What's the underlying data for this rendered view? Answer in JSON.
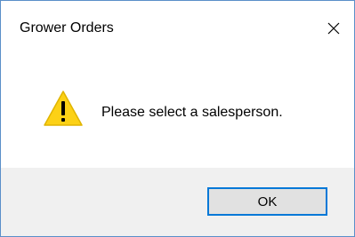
{
  "window": {
    "title": "Grower Orders",
    "close_icon": "close-icon"
  },
  "message": {
    "icon": "warning-icon",
    "text": "Please select a salesperson."
  },
  "buttons": {
    "ok_label": "OK"
  },
  "colors": {
    "window_border": "#5a8fc9",
    "footer_background": "#f0f0f0",
    "button_focus_border": "#0078d7",
    "button_background": "#e1e1e1",
    "warning_fill": "#fcd116"
  }
}
